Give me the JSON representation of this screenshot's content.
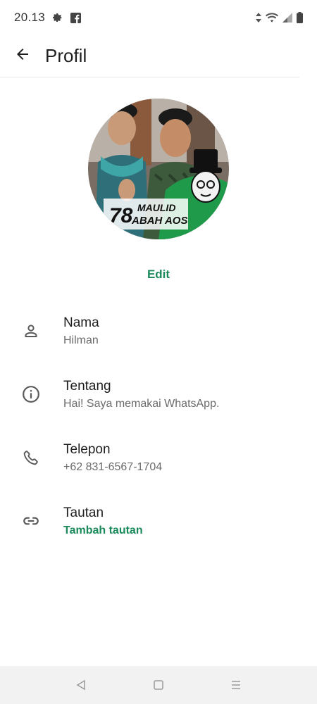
{
  "status_bar": {
    "time": "20.13",
    "icons": [
      "gear-icon",
      "facebook-icon",
      "data-arrows-icon",
      "wifi-icon",
      "signal-icon",
      "battery-icon"
    ]
  },
  "app_bar": {
    "title": "Profil",
    "back_icon": "arrow-left-icon"
  },
  "profile": {
    "photo_caption_line1": "78",
    "photo_caption_line2": "MAULID",
    "photo_caption_line3": "ABAH AOS",
    "edit_label": "Edit"
  },
  "rows": [
    {
      "icon": "person-icon",
      "label": "Nama",
      "value": "Hilman"
    },
    {
      "icon": "info-icon",
      "label": "Tentang",
      "value": "Hai! Saya memakai WhatsApp."
    },
    {
      "icon": "phone-icon",
      "label": "Telepon",
      "value": "+62 831-6567-1704"
    },
    {
      "icon": "link-icon",
      "label": "Tautan",
      "value": "Tambah tautan"
    }
  ],
  "nav_bar": {
    "icons": [
      "back-triangle-icon",
      "home-square-icon",
      "menu-lines-icon"
    ]
  },
  "colors": {
    "accent": "#1b8a5a",
    "text_primary": "#1f1f1f",
    "text_secondary": "#6b6b6b",
    "nav_bg": "#f2f2f2"
  }
}
